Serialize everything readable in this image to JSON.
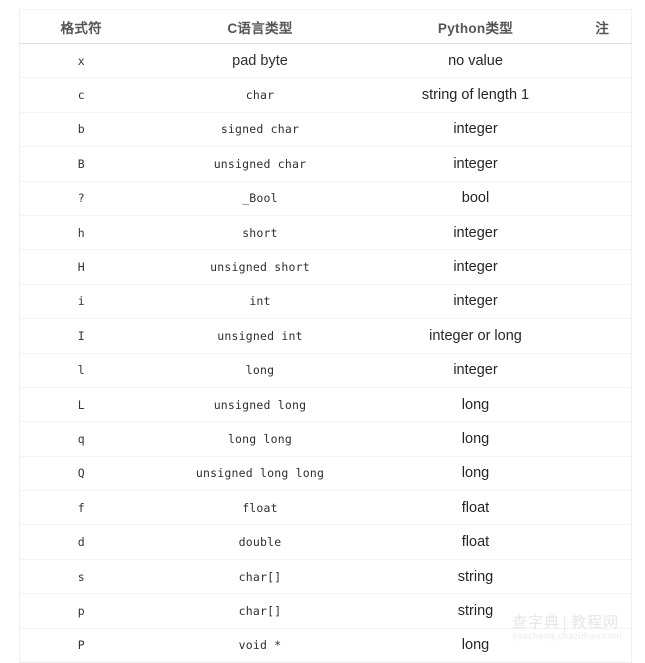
{
  "table": {
    "headers": [
      {
        "label": "格式符",
        "key": "fmt"
      },
      {
        "label": "C语言类型",
        "key": "ctype"
      },
      {
        "label": "Python类型",
        "key": "pytype"
      },
      {
        "label": "注",
        "key": "note"
      }
    ],
    "rows": [
      {
        "fmt": "x",
        "ctype": "pad byte",
        "ctype_font": "sans",
        "pytype": "no value",
        "note": ""
      },
      {
        "fmt": "c",
        "ctype": "char",
        "ctype_font": "mono",
        "pytype": "string of length 1",
        "note": ""
      },
      {
        "fmt": "b",
        "ctype": "signed char",
        "ctype_font": "mono",
        "pytype": "integer",
        "note": ""
      },
      {
        "fmt": "B",
        "ctype": "unsigned char",
        "ctype_font": "mono",
        "pytype": "integer",
        "note": ""
      },
      {
        "fmt": "?",
        "ctype": "_Bool",
        "ctype_font": "mono",
        "pytype": "bool",
        "note": ""
      },
      {
        "fmt": "h",
        "ctype": "short",
        "ctype_font": "mono",
        "pytype": "integer",
        "note": ""
      },
      {
        "fmt": "H",
        "ctype": "unsigned short",
        "ctype_font": "mono",
        "pytype": "integer",
        "note": ""
      },
      {
        "fmt": "i",
        "ctype": "int",
        "ctype_font": "mono",
        "pytype": "integer",
        "note": ""
      },
      {
        "fmt": "I",
        "ctype": "unsigned int",
        "ctype_font": "mono",
        "pytype": "integer or long",
        "note": ""
      },
      {
        "fmt": "l",
        "ctype": "long",
        "ctype_font": "mono",
        "pytype": "integer",
        "note": ""
      },
      {
        "fmt": "L",
        "ctype": "unsigned long",
        "ctype_font": "mono",
        "pytype": "long",
        "note": ""
      },
      {
        "fmt": "q",
        "ctype": "long long",
        "ctype_font": "mono",
        "pytype": "long",
        "note": ""
      },
      {
        "fmt": "Q",
        "ctype": "unsigned long long",
        "ctype_font": "mono",
        "pytype": "long",
        "note": ""
      },
      {
        "fmt": "f",
        "ctype": "float",
        "ctype_font": "mono",
        "pytype": "float",
        "note": ""
      },
      {
        "fmt": "d",
        "ctype": "double",
        "ctype_font": "mono",
        "pytype": "float",
        "note": ""
      },
      {
        "fmt": "s",
        "ctype": "char[]",
        "ctype_font": "mono",
        "pytype": "string",
        "note": ""
      },
      {
        "fmt": "p",
        "ctype": "char[]",
        "ctype_font": "mono",
        "pytype": "string",
        "note": ""
      },
      {
        "fmt": "P",
        "ctype": "void *",
        "ctype_font": "mono",
        "pytype": "long",
        "note": ""
      }
    ]
  },
  "watermark": {
    "brand": "查字典",
    "separator": "|",
    "section": "教程网",
    "url": "jiaocheng.chazidian.com"
  },
  "colors": {
    "text": "#2b2b2b",
    "header_text": "#555555",
    "row_border": "#f2f2f2",
    "header_border": "#e2e2e2",
    "background": "#ffffff",
    "watermark": "#b5b5b5"
  }
}
